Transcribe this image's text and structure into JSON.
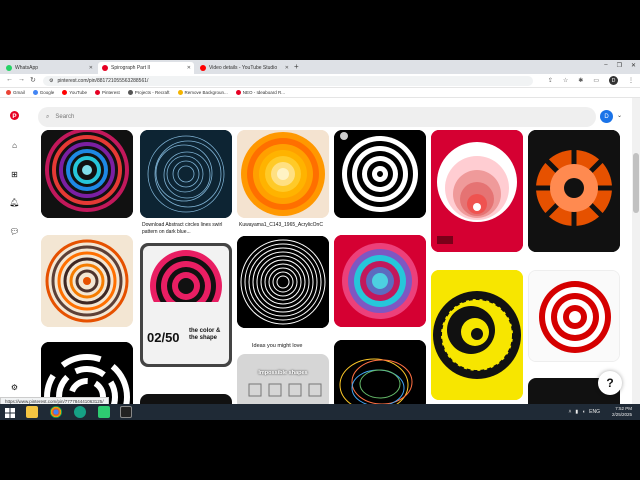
{
  "browser": {
    "tabs": [
      {
        "label": "WhatsApp",
        "color": "#25d366"
      },
      {
        "label": "Spirograph Part II",
        "color": "#e60023"
      },
      {
        "label": "Video details - YouTube Studio",
        "color": "#ff0000"
      }
    ],
    "url": "pinterest.com/pin/881721055563288561/",
    "bookmarks": [
      {
        "label": "Gmail",
        "color": "#ea4335"
      },
      {
        "label": "Google",
        "color": "#4285f4"
      },
      {
        "label": "YouTube",
        "color": "#ff0000"
      },
      {
        "label": "Pinterest",
        "color": "#e60023"
      },
      {
        "label": "Projects - Recraft",
        "color": "#555555"
      },
      {
        "label": "Remove Backgroun...",
        "color": "#f4b400"
      },
      {
        "label": "NEO - Ideaboard R...",
        "color": "#e60023"
      }
    ],
    "profile_initial": "D",
    "status_url": "https://www.pinterest.com/pin/777784441063125/"
  },
  "pinterest": {
    "search_placeholder": "Search",
    "user_initial": "D",
    "captions": {
      "pin2": "Download Abstract circles lines swirl pattern on dark blue...",
      "pin3": "Kuwayama1_C143_1965_AcrylicOnC",
      "ideas": "Ideas you might love",
      "impossible": "Impossible shapes",
      "poster_num": "02/50",
      "poster_title": "the color & the shape"
    },
    "help": "?"
  },
  "taskbar": {
    "time": "7:52 PM",
    "date": "2/25/2025",
    "lang": "ENG"
  }
}
